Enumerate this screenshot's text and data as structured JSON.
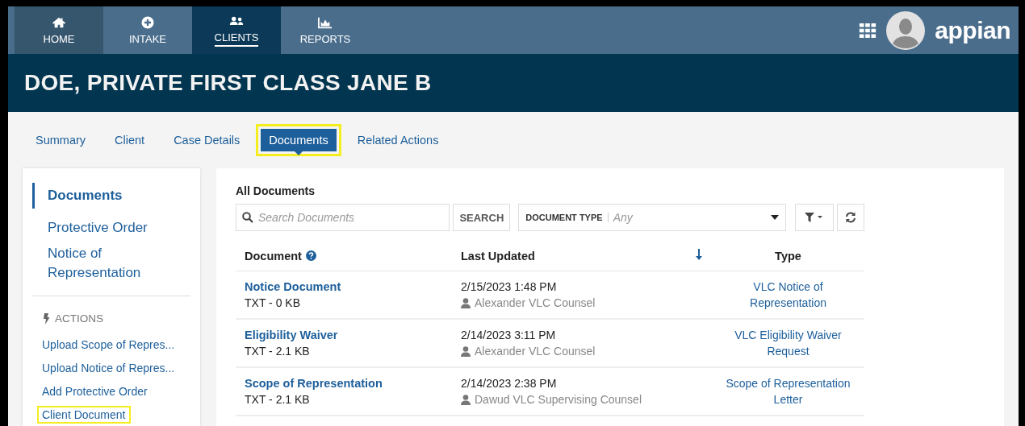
{
  "nav": {
    "items": [
      {
        "label": "HOME",
        "selected": false,
        "hovered": true
      },
      {
        "label": "INTAKE",
        "selected": false,
        "hovered": false
      },
      {
        "label": "CLIENTS",
        "selected": true,
        "hovered": false
      },
      {
        "label": "REPORTS",
        "selected": false,
        "hovered": false
      }
    ],
    "logo": "appian"
  },
  "page_title": "DOE, PRIVATE FIRST CLASS JANE B",
  "tabs": [
    {
      "label": "Summary",
      "selected": false,
      "highlighted": false
    },
    {
      "label": "Client",
      "selected": false,
      "highlighted": false
    },
    {
      "label": "Case Details",
      "selected": false,
      "highlighted": false
    },
    {
      "label": "Documents",
      "selected": true,
      "highlighted": true
    },
    {
      "label": "Related Actions",
      "selected": false,
      "highlighted": false
    }
  ],
  "sidebar": {
    "items": [
      {
        "label": "Documents",
        "selected": true
      },
      {
        "label": "Protective Order",
        "selected": false
      },
      {
        "label": "Notice of Representation",
        "selected": false
      }
    ],
    "actions_heading": "ACTIONS",
    "actions": [
      {
        "label": "Upload Scope of Repres...",
        "highlighted": false
      },
      {
        "label": "Upload Notice of Repres...",
        "highlighted": false
      },
      {
        "label": "Add Protective Order",
        "highlighted": false
      },
      {
        "label": "Client Document",
        "highlighted": true
      }
    ]
  },
  "documents": {
    "title": "All Documents",
    "search": {
      "placeholder": "Search Documents",
      "button": "SEARCH"
    },
    "type_filter": {
      "label": "DOCUMENT TYPE",
      "placeholder": "Any"
    },
    "columns": [
      "Document",
      "Last Updated",
      "Type"
    ],
    "rows": [
      {
        "name": "Notice Document",
        "size": "TXT - 0 KB",
        "updated": "2/15/2023 1:48 PM",
        "user": "Alexander VLC Counsel",
        "type": "VLC Notice of Representation"
      },
      {
        "name": "Eligibility Waiver",
        "size": "TXT - 2.1 KB",
        "updated": "2/14/2023 3:11 PM",
        "user": "Alexander VLC Counsel",
        "type": "VLC Eligibility Waiver Request"
      },
      {
        "name": "Scope of Representation",
        "size": "TXT - 2.1 KB",
        "updated": "2/14/2023 2:38 PM",
        "user": "Dawud VLC Supervising Counsel",
        "type": "Scope of Representation Letter"
      }
    ]
  }
}
